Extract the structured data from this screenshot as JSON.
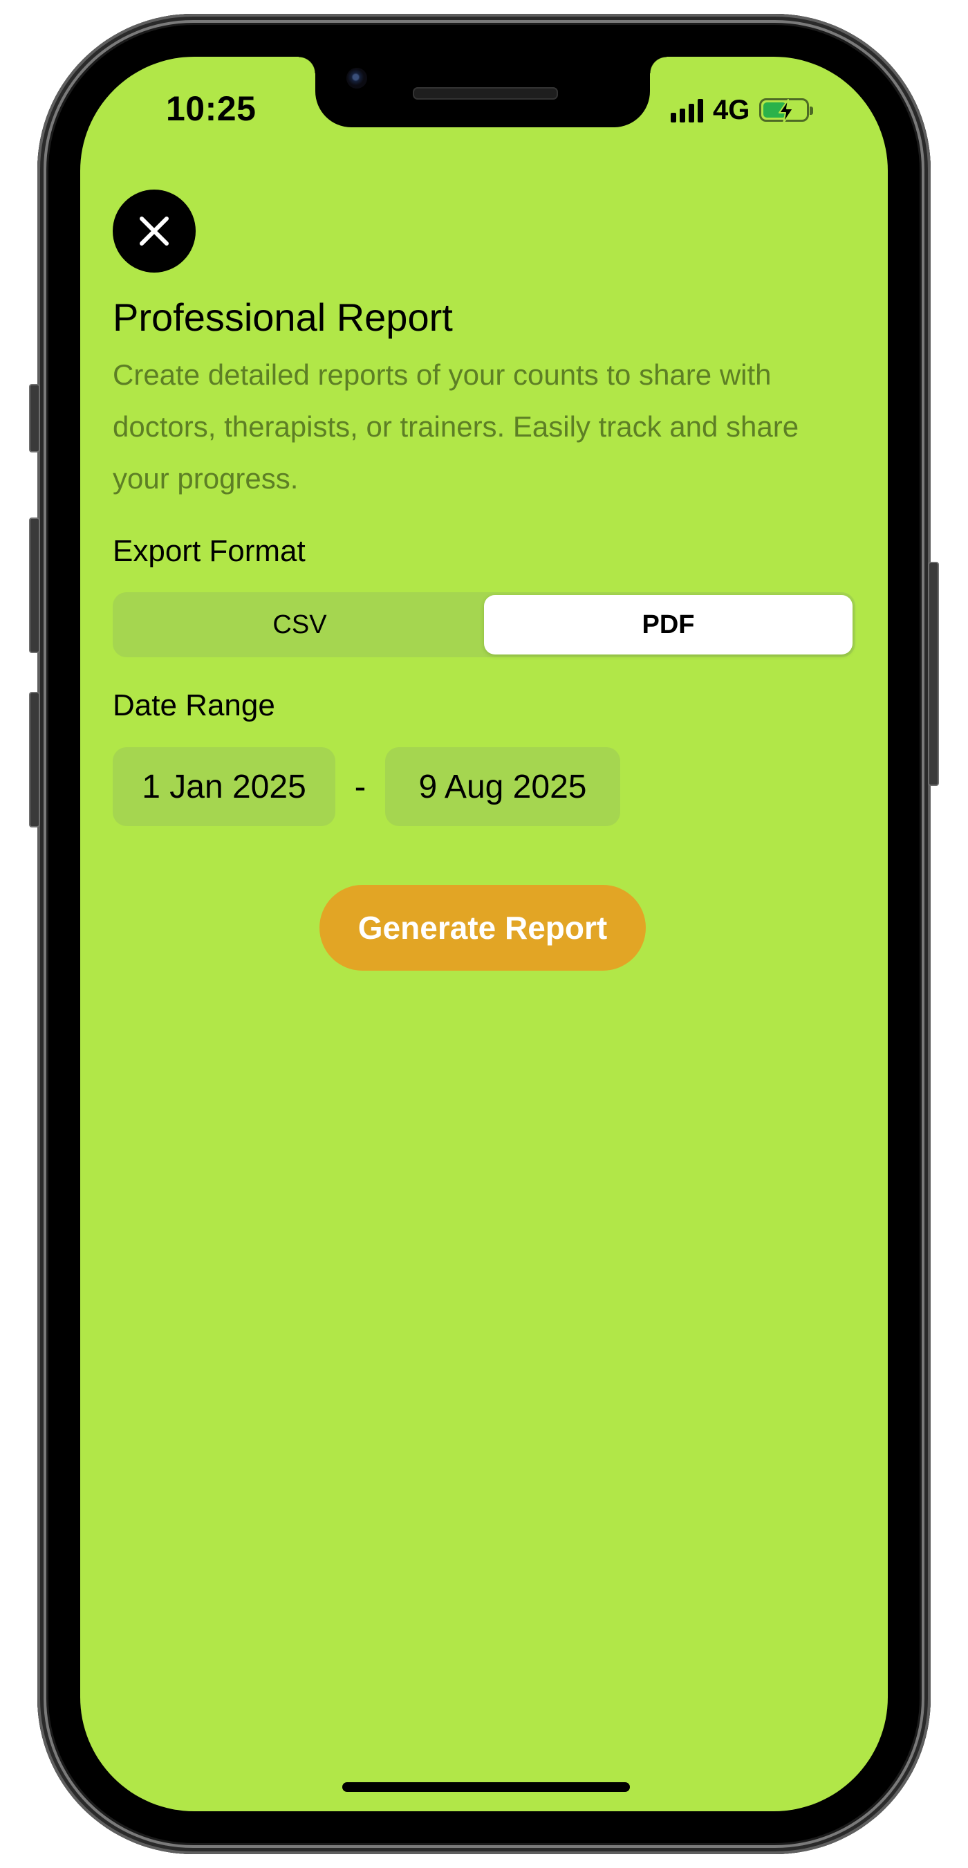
{
  "status_bar": {
    "time": "10:25",
    "network": "4G",
    "battery_level": 0.55,
    "battery_charging": true
  },
  "header": {
    "close_icon": "close-icon",
    "title": "Professional Report",
    "description": "Create detailed reports of your counts to share with doctors, therapists, or trainers. Easily track and share your progress."
  },
  "export_format": {
    "label": "Export Format",
    "options": [
      "CSV",
      "PDF"
    ],
    "selected": "PDF"
  },
  "date_range": {
    "label": "Date Range",
    "start": "1 Jan 2025",
    "separator": "-",
    "end": "9 Aug 2025"
  },
  "actions": {
    "generate_label": "Generate Report"
  },
  "colors": {
    "background": "#b1e748",
    "accent_button": "#e2a525",
    "description_text": "#5d7f25",
    "control_fill": "#a5d650"
  }
}
